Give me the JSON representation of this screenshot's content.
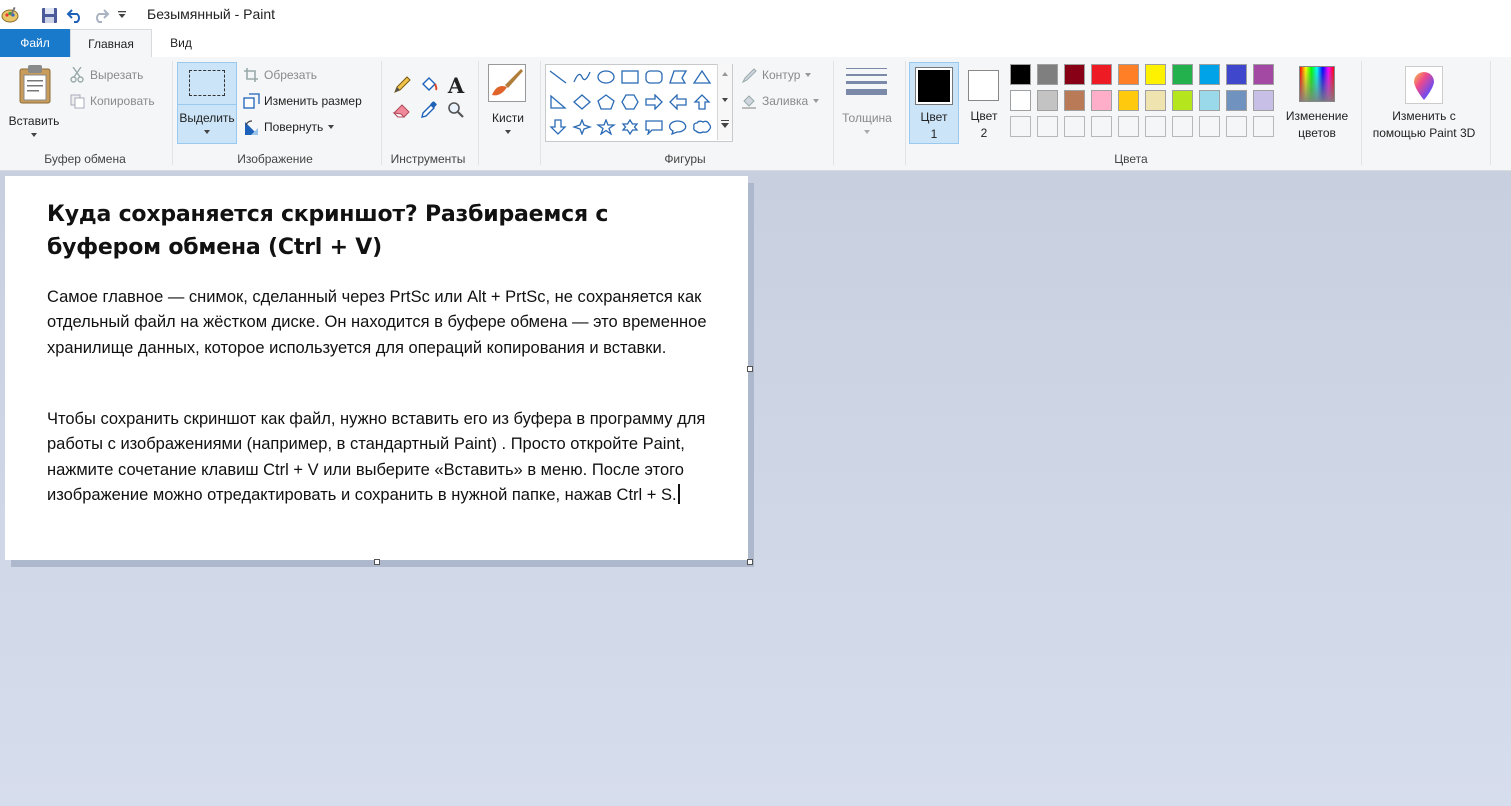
{
  "window": {
    "title": "Безымянный - Paint"
  },
  "quick_access": {
    "icons": [
      "paint-app-icon",
      "save-icon",
      "undo-icon",
      "redo-icon",
      "customize-dropdown-icon"
    ]
  },
  "tabs": {
    "file": "Файл",
    "home": "Главная",
    "view": "Вид"
  },
  "clipboard": {
    "paste": "Вставить",
    "cut": "Вырезать",
    "copy": "Копировать",
    "group": "Буфер обмена"
  },
  "image": {
    "select": "Выделить",
    "crop": "Обрезать",
    "resize": "Изменить размер",
    "rotate": "Повернуть",
    "group": "Изображение"
  },
  "tools": {
    "group": "Инструменты"
  },
  "brushes": {
    "label": "Кисти"
  },
  "shapes": {
    "outline": "Контур",
    "fill": "Заливка",
    "group": "Фигуры"
  },
  "size": {
    "label": "Толщина"
  },
  "colors": {
    "color1_a": "Цвет",
    "color1_b": "1",
    "color2_a": "Цвет",
    "color2_b": "2",
    "color1_value": "#000000",
    "color2_value": "#ffffff",
    "edit_a": "Изменение",
    "edit_b": "цветов",
    "paint3d_a": "Изменить с",
    "paint3d_b": "помощью Paint 3D",
    "group": "Цвета",
    "palette_row1": [
      "#000000",
      "#7f7f7f",
      "#880015",
      "#ed1c24",
      "#ff7f27",
      "#fff200",
      "#22b14c",
      "#00a2e8",
      "#3f48cc",
      "#a349a4"
    ],
    "palette_row2": [
      "#ffffff",
      "#c3c3c3",
      "#b97a57",
      "#ffaec9",
      "#ffc90e",
      "#efe4b0",
      "#b5e61d",
      "#99d9ea",
      "#7092be",
      "#c8bfe7"
    ],
    "accent": "#1979ca"
  },
  "document": {
    "heading": "Куда сохраняется скриншот? Разбираемся с буфером обмена (Ctrl + V)",
    "paragraph1": "Самое главное — снимок, сделанный через PrtSc или Alt + PrtSc, не сохраняется как отдельный файл на жёстком диске. Он находится в буфере обмена — это временное хранилище данных, которое используется для операций копирования и вставки.",
    "paragraph2": "Чтобы сохранить скриншот как файл, нужно вставить его из буфера в программу для работы с изображениями (например, в стандартный Paint) . Просто откройте Paint, нажмите сочетание клавиш Ctrl + V или выберите «Вставить» в меню. После этого изображение можно отредактировать и сохранить в нужной папке, нажав Ctrl + S."
  }
}
